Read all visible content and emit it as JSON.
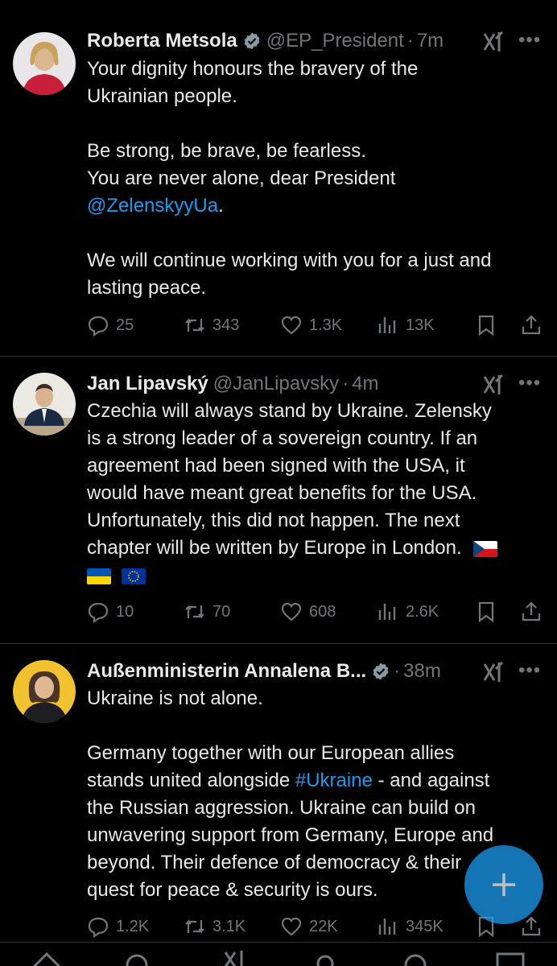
{
  "tweets": [
    {
      "name": "Roberta Metsola",
      "verified": true,
      "handle": "@EP_President",
      "time": "7m",
      "lines": [
        "Your dignity honours the bravery of the",
        "Ukrainian people.",
        "",
        "Be strong, be brave, be fearless.",
        "You are never alone, dear President",
        "@ZelenskyyUa.",
        "",
        "We will continue working with you for a just and",
        "lasting peace."
      ],
      "link_text": "@ZelenskyyUa",
      "link_suffix": ".",
      "replies": "25",
      "reposts": "343",
      "likes": "1.3K",
      "views": "13K"
    },
    {
      "name": "Jan Lipavský",
      "verified": false,
      "handle": "@JanLipavsky",
      "time": "4m",
      "lines": [
        "Czechia will always stand by Ukraine. Zelensky",
        "is a strong leader of a sovereign country. If an",
        "agreement had been signed with the USA, it",
        "would have meant great benefits for the USA.",
        "Unfortunately, this did not happen. The next",
        "chapter will be written by Europe in London."
      ],
      "flags": [
        "czech-flag",
        "ukraine-flag",
        "eu-flag"
      ],
      "replies": "10",
      "reposts": "70",
      "likes": "608",
      "views": "2.6K"
    },
    {
      "name": "Außenministerin Annalena B...",
      "verified": true,
      "time": "38m",
      "line1": "Ukraine is not alone.",
      "line2": "Germany together with our European allies",
      "line3_pre": "stands united alongside ",
      "hashtag": "#Ukraine",
      "line3_post": " - and against",
      "line4": "the Russian aggression. Ukraine can build on",
      "line5": "unwavering support from Germany, Europe and",
      "line6": "beyond. Their defence of democracy & their",
      "line7": "quest for peace & security is ours.",
      "replies": "1.2K",
      "reposts": "3.1K",
      "likes": "22K",
      "views": "345K"
    }
  ],
  "colors": {
    "accent": "#1d9bf0",
    "muted": "#71767b",
    "text": "#e7e9ea",
    "background": "#000000"
  },
  "icons": [
    "reply-icon",
    "repost-icon",
    "like-icon",
    "views-icon",
    "bookmark-icon",
    "share-icon",
    "grok-icon",
    "more-icon",
    "verified-icon",
    "compose-icon"
  ]
}
